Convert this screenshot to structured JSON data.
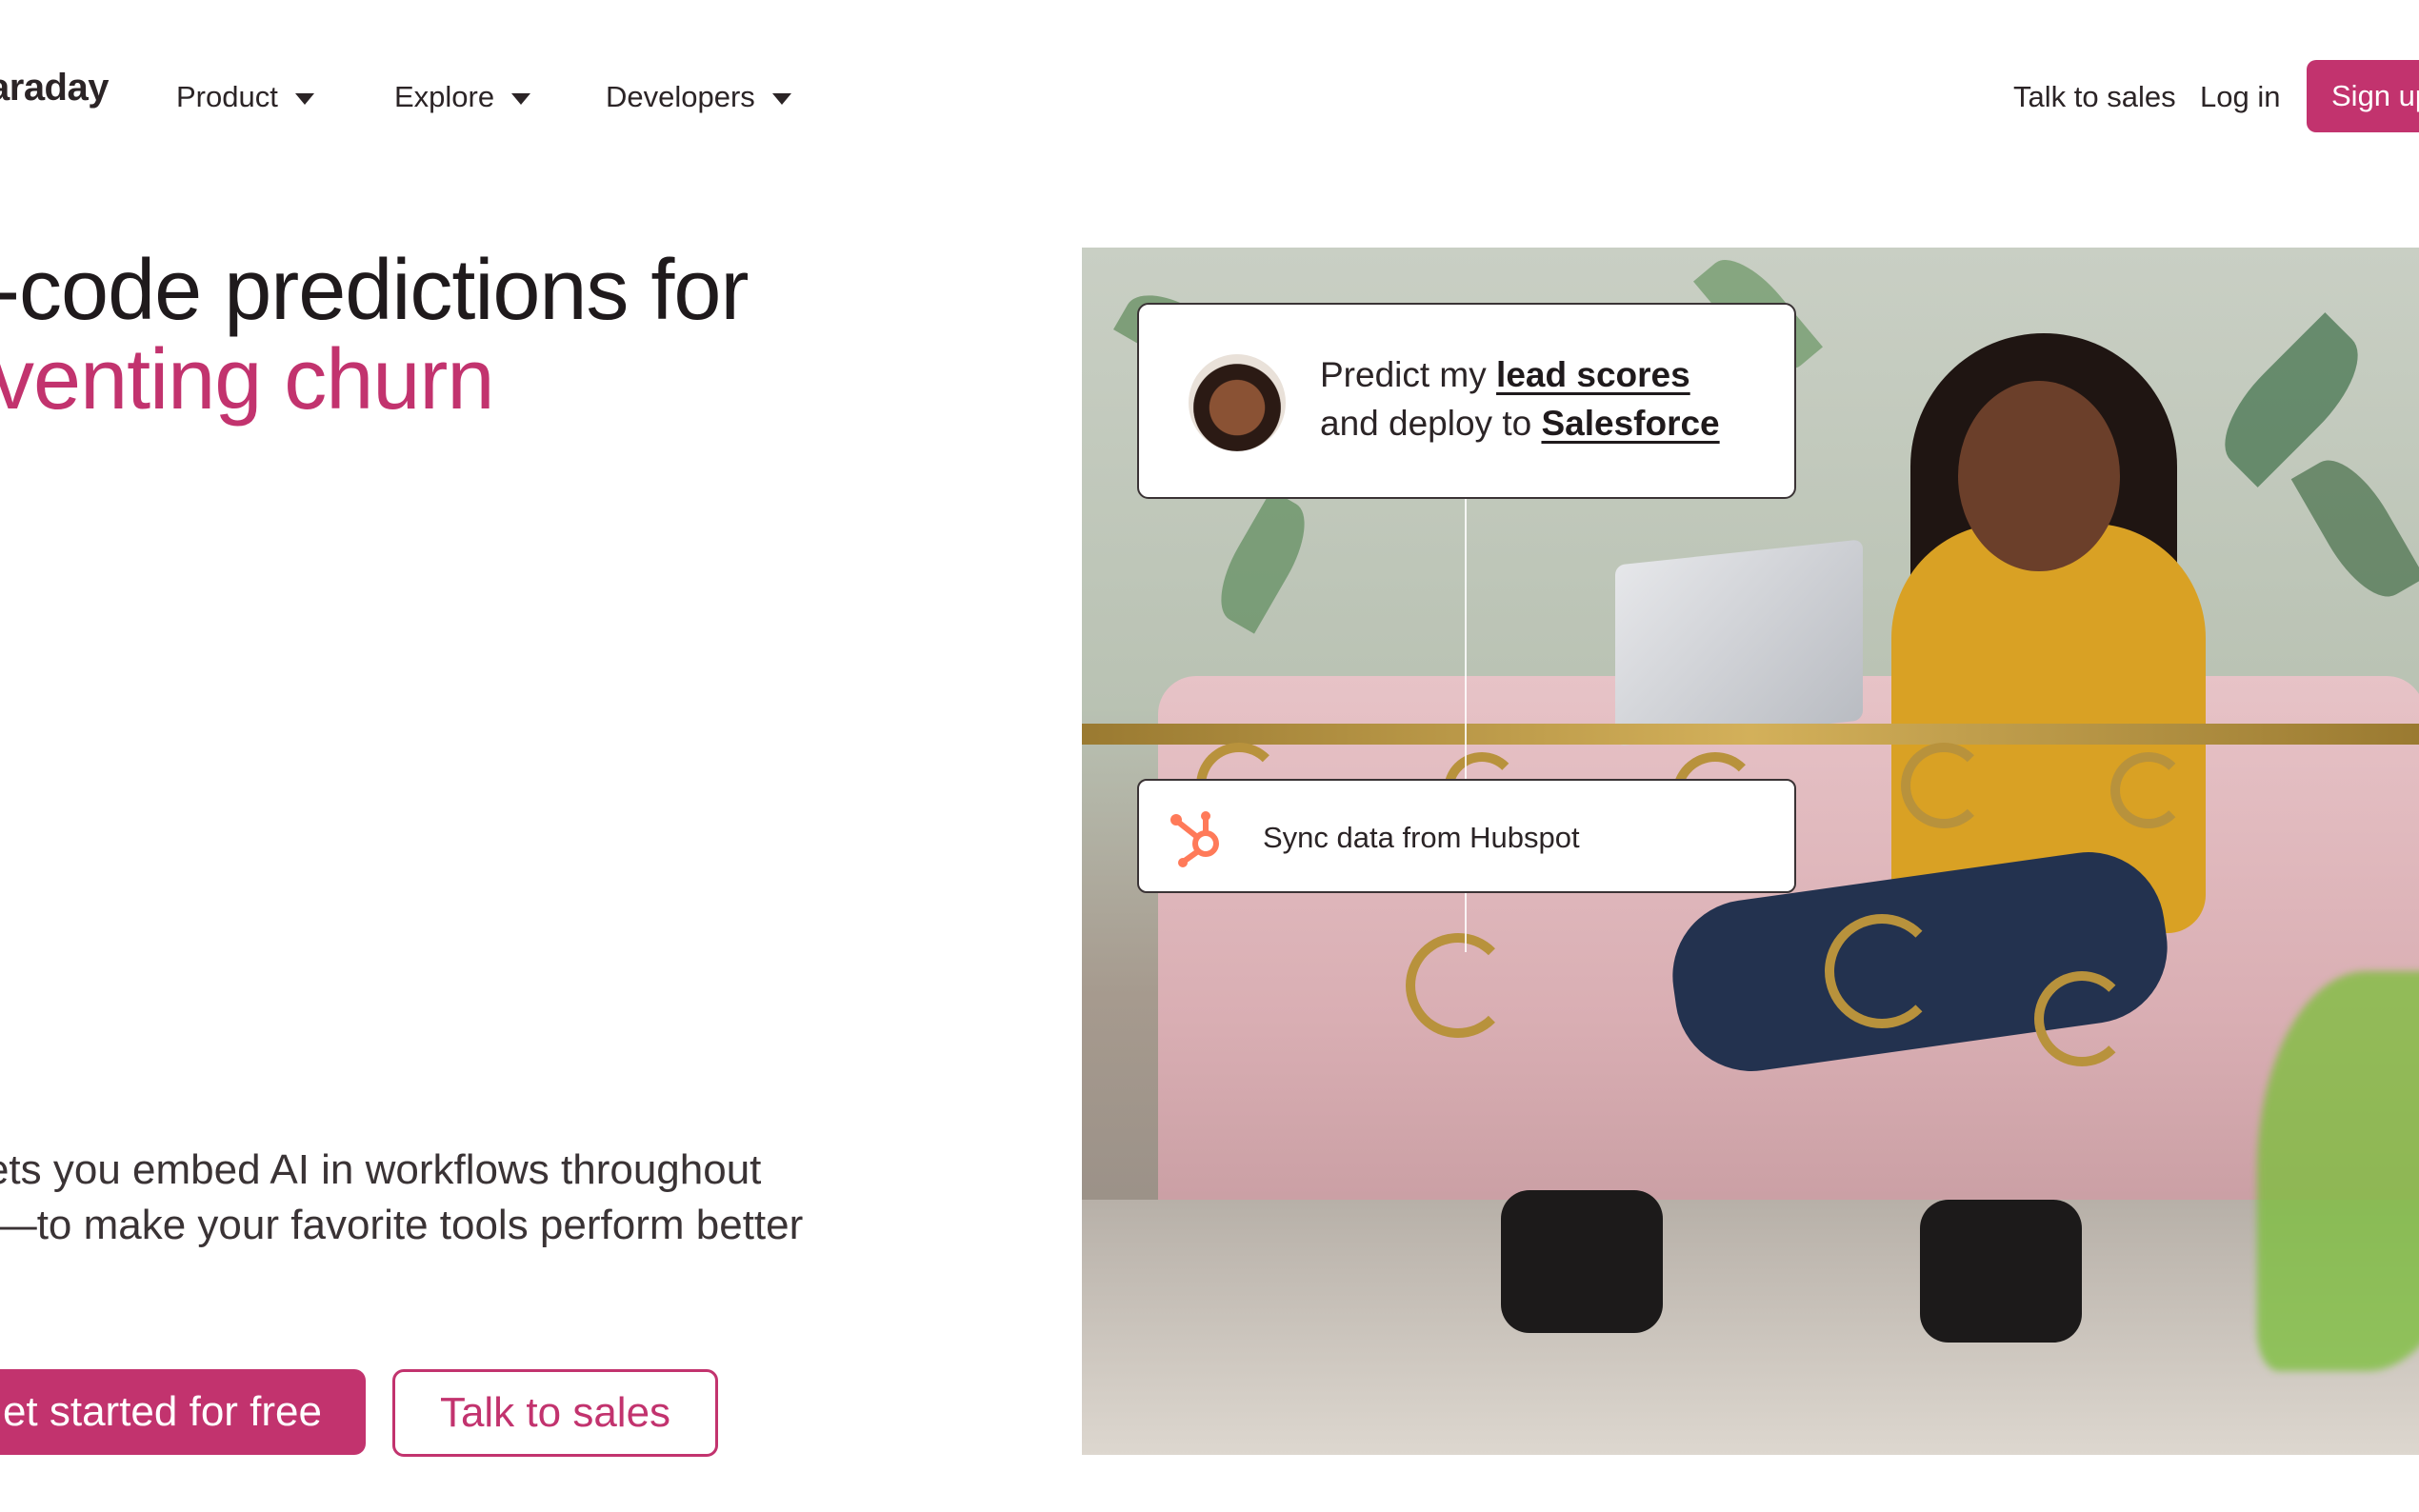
{
  "nav": {
    "logo": "araday",
    "menu": [
      {
        "label": "Product"
      },
      {
        "label": "Explore"
      },
      {
        "label": "Developers"
      }
    ],
    "talk_to_sales": "Talk to sales",
    "log_in": "Log in",
    "sign_up": "Sign up"
  },
  "hero": {
    "headline_line1": "o-code predictions for",
    "headline_line2": "eventing churn",
    "subtext": "day lets you embed AI in workflows throughout stack—to make your favorite tools perform better",
    "cta_primary": "et started for free",
    "cta_secondary": "Talk to sales"
  },
  "visual": {
    "predict_card": {
      "prefix1": "Predict my ",
      "link1": "lead scores",
      "prefix2": "and deploy to ",
      "link2": "Salesforce"
    },
    "sync_card": {
      "text": "Sync data from Hubspot"
    }
  },
  "colors": {
    "brand": "#c2336e",
    "text": "#1f1a1c",
    "hubspot": "#ff7a59"
  }
}
